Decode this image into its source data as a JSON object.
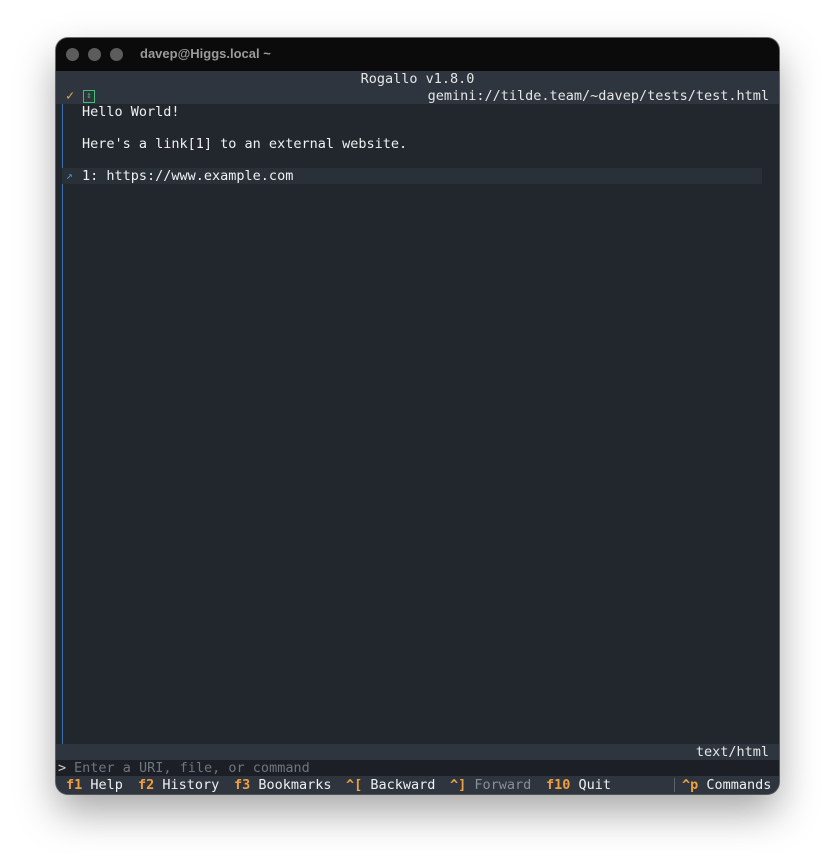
{
  "window": {
    "title": "davep@Higgs.local ~"
  },
  "app": {
    "title": "Rogallo v1.8.0"
  },
  "status": {
    "url": "gemini://tilde.team/~davep/tests/test.html",
    "mime": "text/html"
  },
  "document": {
    "lines": [
      "Hello World!",
      "Here's a link[1] to an external website."
    ],
    "link": "1: https://www.example.com"
  },
  "command": {
    "prompt": ">",
    "placeholder": "Enter a URI, file, or command"
  },
  "footer": {
    "items": [
      {
        "key": "f1",
        "label": "Help"
      },
      {
        "key": "f2",
        "label": "History"
      },
      {
        "key": "f3",
        "label": "Bookmarks"
      },
      {
        "key": "^[",
        "label": "Backward"
      },
      {
        "key": "^]",
        "label": "Forward"
      },
      {
        "key": "f10",
        "label": "Quit"
      },
      {
        "key": "^p",
        "label": "Commands"
      }
    ]
  },
  "colors": {
    "accent": "#f0a040",
    "background": "#22272e",
    "link_arrow": "#4a9bea",
    "secure": "#3fbf72"
  }
}
